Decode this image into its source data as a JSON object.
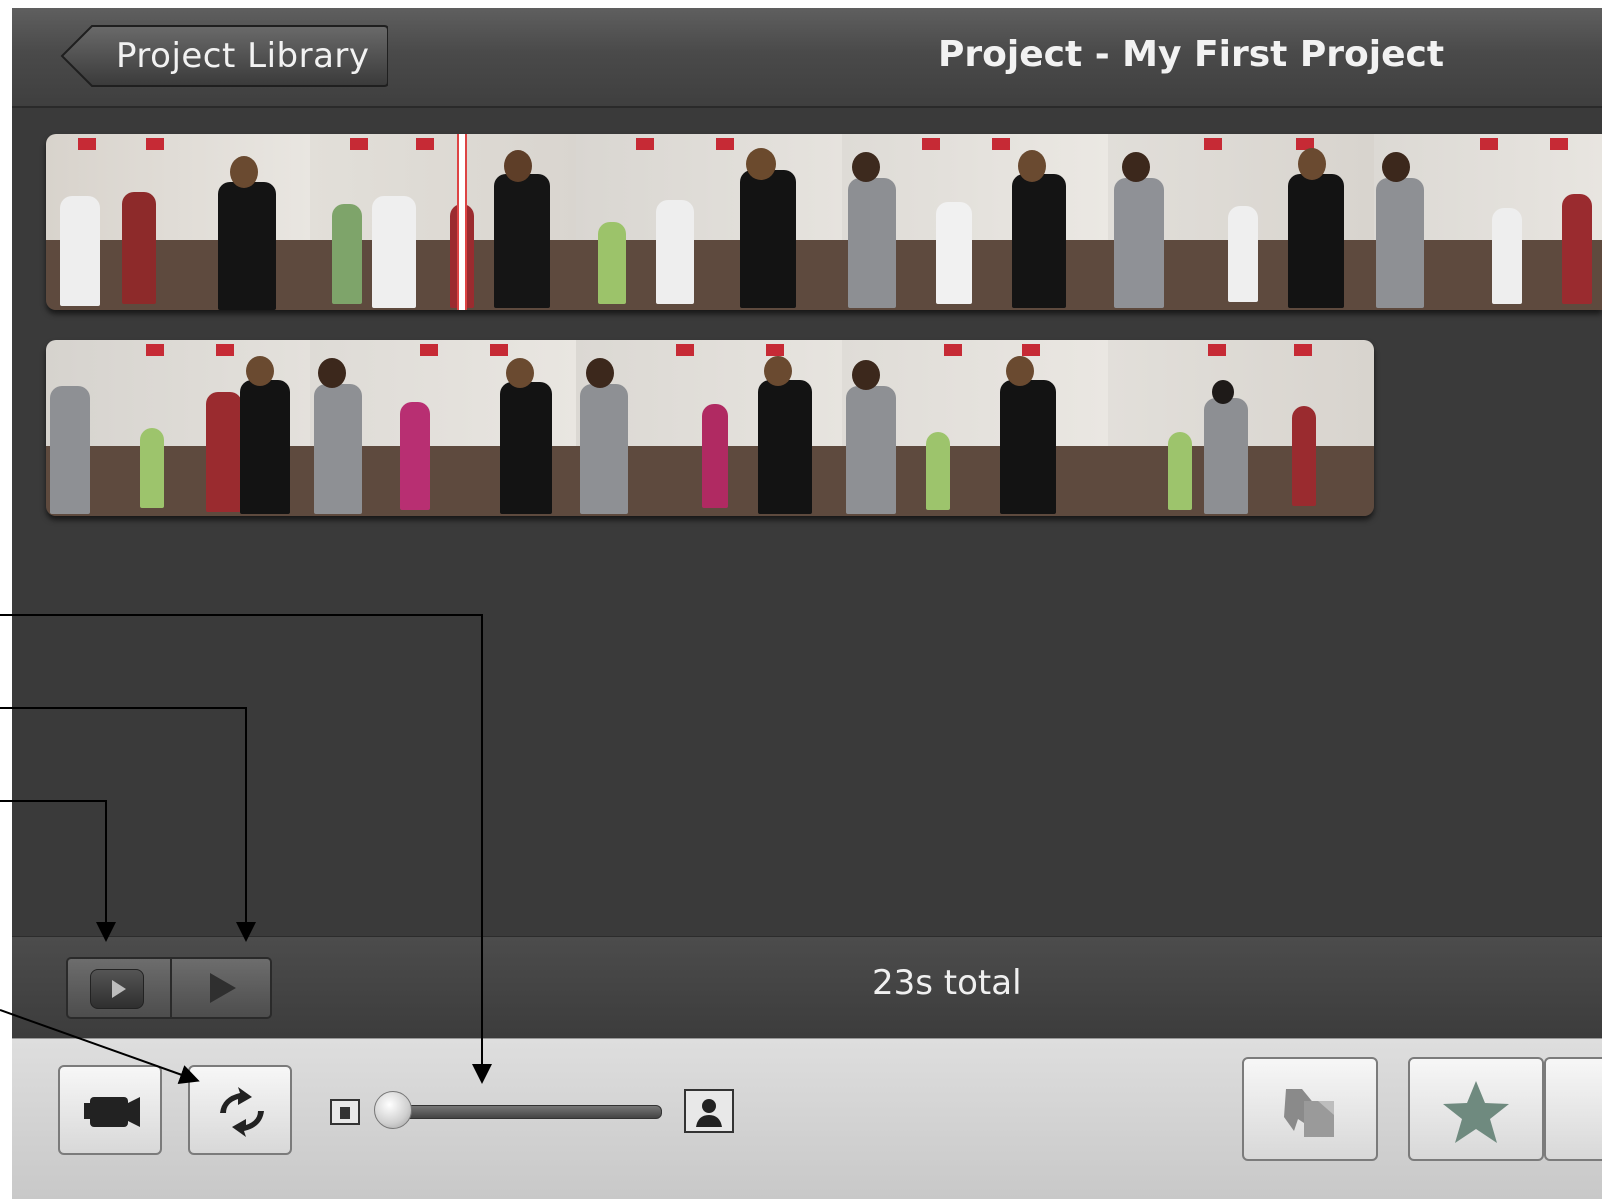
{
  "header": {
    "back_button_label": "Project Library",
    "title": "Project - My First Project"
  },
  "status": {
    "total_duration": "23s total"
  },
  "toolbar": {
    "icons": [
      "camera-icon",
      "swap-icon",
      "small-thumbnail-icon",
      "large-thumbnail-icon",
      "favorite-reject-icon",
      "star-icon"
    ],
    "zoom_slider_value": 0.0
  },
  "filmstrips": {
    "row1_frame_count": 6,
    "row2_frame_count": 5
  },
  "colors": {
    "window_bg": "#3a3a3a",
    "toolbar_bg": "#d4d4d4",
    "playhead": "#d44444",
    "star": "#6f8a7f"
  }
}
